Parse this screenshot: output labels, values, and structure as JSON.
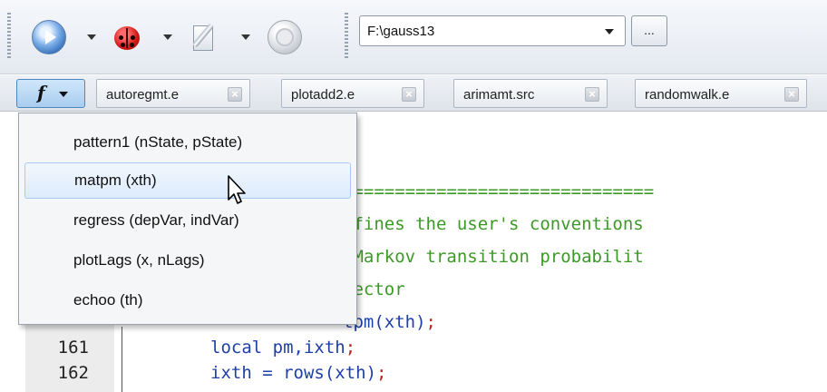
{
  "toolbar": {
    "run_icon": "play-icon",
    "debug_icon": "ladybug-icon",
    "edit_icon": "edit-icon",
    "stop_icon": "stop-icon",
    "path_value": "F:\\gauss13",
    "browse_label": "..."
  },
  "function_button": {
    "label": "f",
    "icon": "function-icon"
  },
  "tabs": [
    {
      "label": "autoregmt.e"
    },
    {
      "label": "plotadd2.e"
    },
    {
      "label": "arimamt.src"
    },
    {
      "label": "randomwalk.e"
    }
  ],
  "close_glyph": "×",
  "menu": {
    "items": [
      {
        "label": "pattern1 (nState, pState)"
      },
      {
        "label": "matpm (xth)"
      },
      {
        "label": "regress (depVar, indVar)"
      },
      {
        "label": "plotLags (x, nLags)"
      },
      {
        "label": "echoo (th)"
      }
    ],
    "hovered_index": 1
  },
  "editor": {
    "visible_code": [
      {
        "text": "=============================="
      },
      {
        "text": "efines the user's conventions"
      },
      {
        "text": " Markov transition probabilit"
      },
      {
        "text": "vector"
      },
      {
        "part1": "tpm(xth)",
        "part2": ";"
      },
      {
        "line": "161",
        "part1": "local pm,ixth",
        "part2": ";"
      },
      {
        "line": "162",
        "part1": "ixth = rows(xth)",
        "part2": ";"
      }
    ]
  },
  "colors": {
    "comment": "#3b9a26",
    "keyword": "#1f3fa8",
    "punctuation": "#b4261f",
    "menu_hover": "#dcebfb"
  }
}
